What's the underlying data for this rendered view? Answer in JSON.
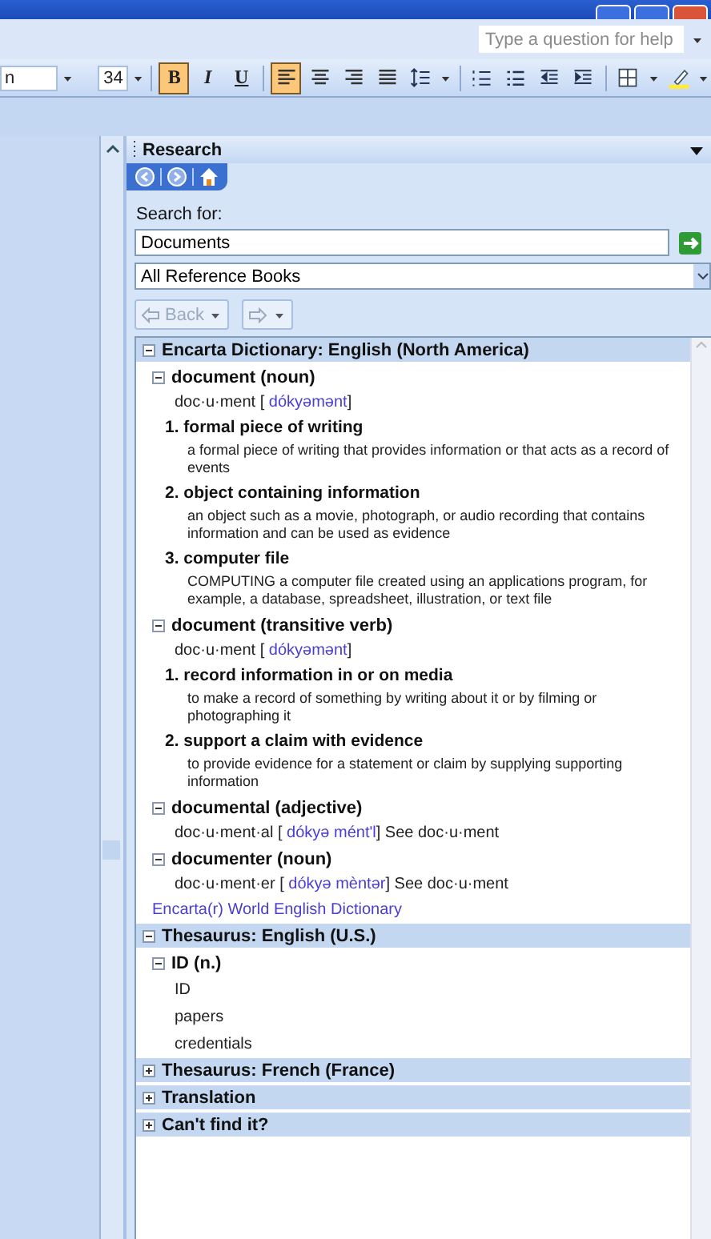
{
  "help_box": {
    "placeholder": "Type a question for help"
  },
  "toolbar": {
    "font_name": "n",
    "font_size": "34",
    "buttons": [
      {
        "kind": "bold",
        "label": "B",
        "selected": true
      },
      {
        "kind": "italic",
        "label": "I",
        "selected": false
      },
      {
        "kind": "underline",
        "label": "U",
        "selected": false
      },
      {
        "kind": "align-left",
        "selected": true
      },
      {
        "kind": "align-center",
        "selected": false
      },
      {
        "kind": "align-right",
        "selected": false
      },
      {
        "kind": "justify",
        "selected": false
      },
      {
        "kind": "line-spacing",
        "selected": false
      },
      {
        "kind": "numbering",
        "selected": false
      },
      {
        "kind": "bullets",
        "selected": false
      },
      {
        "kind": "outdent",
        "selected": false
      },
      {
        "kind": "indent",
        "selected": false
      },
      {
        "kind": "border",
        "selected": false
      },
      {
        "kind": "highlight",
        "selected": false
      }
    ]
  },
  "research": {
    "title": "Research",
    "search_label": "Search for:",
    "search_value": "Documents",
    "source": "All Reference Books",
    "back_label": "Back",
    "sections": [
      {
        "title": "Encarta Dictionary: English (North America)",
        "expanded": true,
        "children": [
          {
            "kind": "headword",
            "title": "document (noun)",
            "expanded": true,
            "children": [
              {
                "kind": "pronunciation",
                "word": "doc·u·ment [",
                "phonetic": "dókyəmənt",
                "tail": "]"
              },
              {
                "kind": "sense",
                "text": "1. formal piece of writing"
              },
              {
                "kind": "definition",
                "text": "a formal piece of writing that provides information or that acts as a record of events"
              },
              {
                "kind": "sense",
                "text": "2. object containing information"
              },
              {
                "kind": "definition",
                "text": "an object such as a movie, photograph, or audio recording that contains information and can be used as evidence"
              },
              {
                "kind": "sense",
                "text": "3. computer file"
              },
              {
                "kind": "definition",
                "text": "COMPUTING a computer file created using an applications program, for example, a database, spreadsheet, illustration, or text file"
              }
            ]
          },
          {
            "kind": "headword",
            "title": "document (transitive verb)",
            "expanded": true,
            "children": [
              {
                "kind": "pronunciation",
                "word": "doc·u·ment [",
                "phonetic": "dókyəmənt",
                "tail": "]"
              },
              {
                "kind": "sense",
                "text": "1. record information in or on media"
              },
              {
                "kind": "definition",
                "text": "to make a record of something by writing about it or by filming or photographing it"
              },
              {
                "kind": "sense",
                "text": "2. support a claim with evidence"
              },
              {
                "kind": "definition",
                "text": "to provide evidence for a statement or claim by supplying supporting information"
              }
            ]
          },
          {
            "kind": "headword",
            "title": "documental (adjective)",
            "expanded": true,
            "children": [
              {
                "kind": "pronunciation",
                "word": "doc·u·ment·al [",
                "phonetic": "dókyə mént'l",
                "tail": "] See doc·u·ment"
              }
            ]
          },
          {
            "kind": "headword",
            "title": "documenter (noun)",
            "expanded": true,
            "children": [
              {
                "kind": "pronunciation",
                "word": "doc·u·ment·er [",
                "phonetic": "dókyə mèntər",
                "tail": "] See doc·u·ment"
              }
            ]
          },
          {
            "kind": "link",
            "text": "Encarta(r) World English Dictionary"
          }
        ]
      },
      {
        "title": "Thesaurus: English (U.S.)",
        "expanded": true,
        "children": [
          {
            "kind": "headword",
            "title": "ID (n.)",
            "expanded": true,
            "children": [
              {
                "kind": "synonym",
                "text": "ID"
              },
              {
                "kind": "synonym",
                "text": "papers"
              },
              {
                "kind": "synonym",
                "text": "credentials"
              }
            ]
          }
        ]
      },
      {
        "title": "Thesaurus: French (France)",
        "expanded": false
      },
      {
        "title": "Translation",
        "expanded": false
      },
      {
        "title": "Can't find it?",
        "expanded": false
      }
    ]
  }
}
